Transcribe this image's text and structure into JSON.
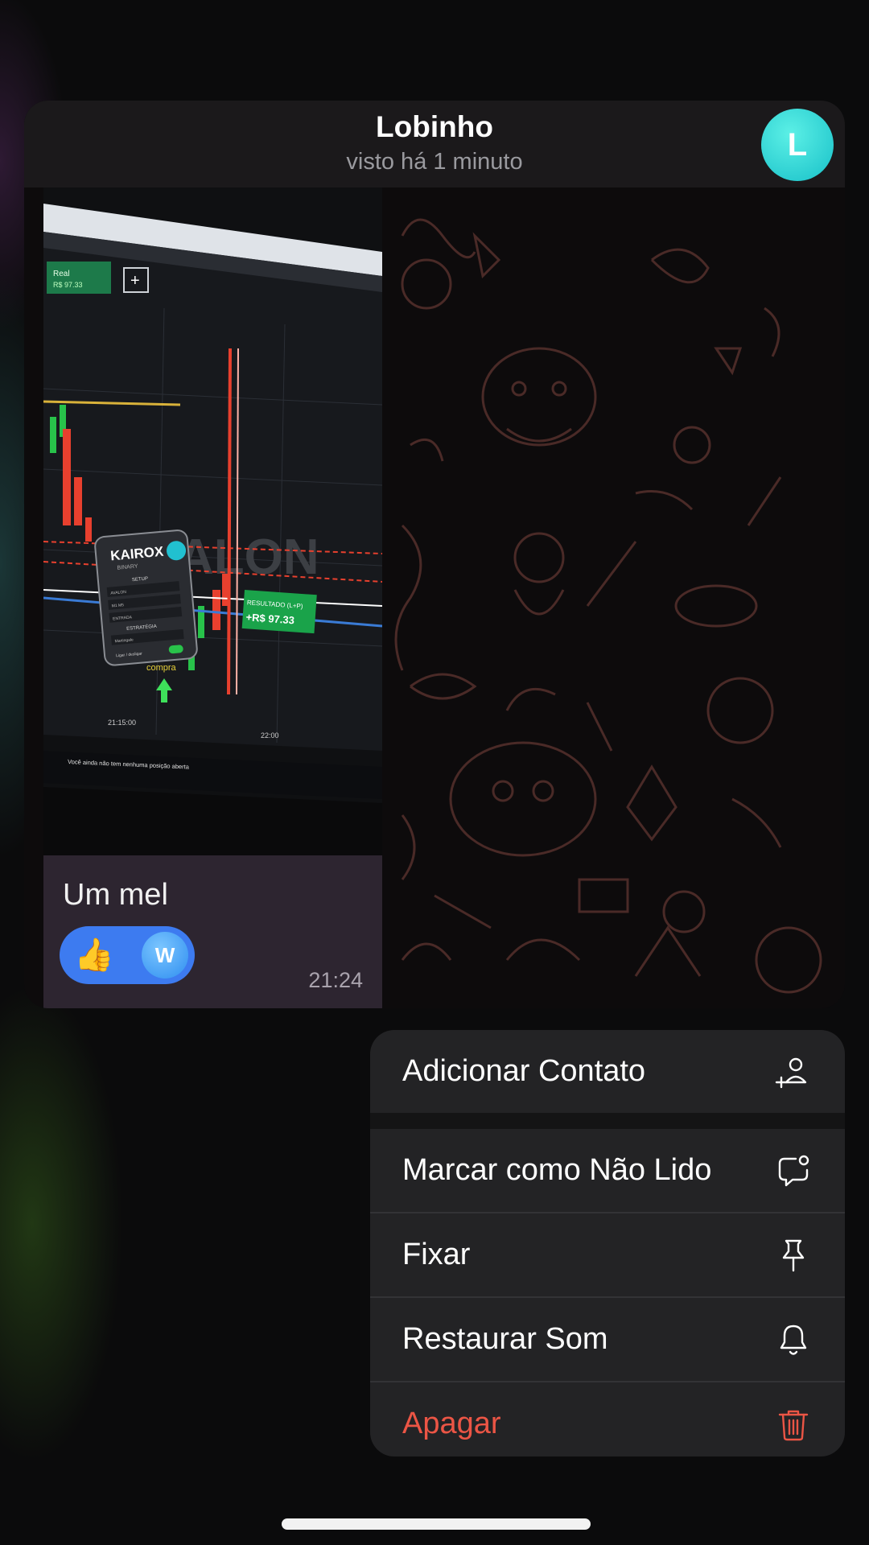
{
  "chat": {
    "name": "Lobinho",
    "status": "visto há 1 minuto",
    "avatar_letter": "L"
  },
  "message": {
    "text": "Um mel",
    "time": "21:24",
    "reaction": {
      "emoji": "👍",
      "avatar_letter": "W"
    },
    "photo": {
      "brand": "KAIROX",
      "brand_sub": "BINARY",
      "watermark": "AVALON",
      "result_label": "RESULTADO (L+P)",
      "result_value": "+R$ 97.33",
      "balance_label": "Real",
      "balance_value": "R$ 97.33",
      "compra_label": "compra",
      "time_label": "21:15:00",
      "time_label_2": "22:00",
      "position_text": "Você ainda não tem nenhuma posição aberta",
      "panel_items": [
        "SETUP",
        "AVALON",
        "M1 M5",
        "ENTRADA",
        "ESTRATÉGIA",
        "Martingale"
      ],
      "panel_toggle_label": "Ligar / desligar"
    }
  },
  "menu": {
    "add_contact": "Adicionar Contato",
    "mark_unread": "Marcar como Não Lido",
    "pin": "Fixar",
    "restore_sound": "Restaurar Som",
    "delete": "Apagar"
  },
  "colors": {
    "danger": "#eb5545",
    "avatar": "#25d0d4",
    "reaction_bg": "#3d7bf0"
  }
}
